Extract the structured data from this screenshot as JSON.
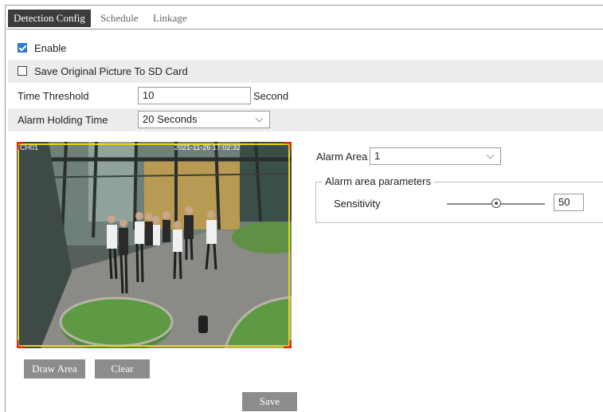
{
  "tabs": [
    {
      "label": "Detection Config",
      "active": true
    },
    {
      "label": "Schedule",
      "active": false
    },
    {
      "label": "Linkage",
      "active": false
    }
  ],
  "enable": {
    "label": "Enable",
    "checked": true
  },
  "save_picture": {
    "label": "Save Original Picture To SD Card",
    "checked": false
  },
  "time_threshold": {
    "label": "Time Threshold",
    "value": "10",
    "unit": "Second"
  },
  "alarm_holding": {
    "label": "Alarm Holding Time",
    "value": "20 Seconds"
  },
  "video": {
    "overlay_left": "CH01",
    "overlay_right": "2021-11-26 17:02:32"
  },
  "buttons": {
    "draw_area": "Draw Area",
    "clear": "Clear",
    "save": "Save"
  },
  "alarm_area": {
    "label": "Alarm Area",
    "value": "1"
  },
  "parameters": {
    "legend": "Alarm area parameters",
    "sensitivity_label": "Sensitivity",
    "sensitivity_value": "50",
    "sensitivity_level": 50
  },
  "colors": {
    "accent": "#2d78d8",
    "tab_active": "#3c3c3c",
    "button": "#8c8c8c",
    "shade": "#ececec",
    "area_border": "#e8d21a",
    "area_corner": "#e02a1a"
  }
}
